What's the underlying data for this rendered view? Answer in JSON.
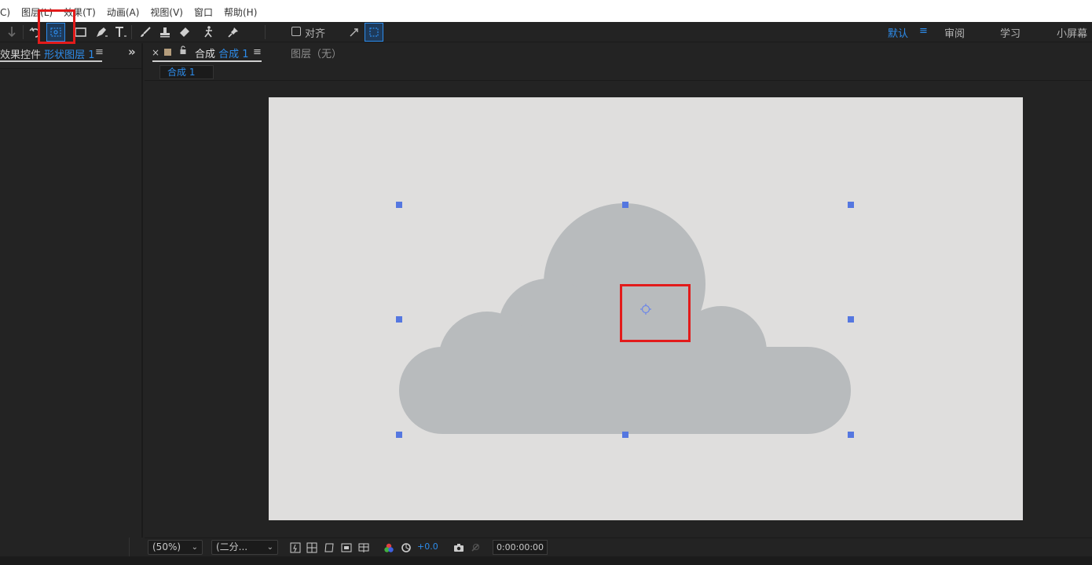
{
  "menu": {
    "items": [
      "C)",
      "图层(L)",
      "效果(T)",
      "动画(A)",
      "视图(V)",
      "窗口",
      "帮助(H)"
    ]
  },
  "toolbar": {
    "tools": [
      "selection-tool",
      "rotate-tool",
      "pan-behind-tool",
      "rectangle-tool",
      "pen-tool",
      "type-tool",
      "brush-tool",
      "clone-stamp-tool",
      "eraser-tool",
      "roto-brush-tool",
      "puppet-pin-tool"
    ],
    "snap_label": "对齐",
    "workspaces": [
      "默认",
      "审阅",
      "学习",
      "小屏幕"
    ],
    "workspace_menu": "≡",
    "active_workspace": "默认"
  },
  "left_panel": {
    "tab_prefix": "效果控件",
    "tab_layer": "形状图层 1",
    "menu_icon": "≡",
    "expand_icon": "»"
  },
  "comp_panel": {
    "close": "×",
    "tab_prefix": "合成",
    "tab_name": "合成 1",
    "menu_icon": "≡",
    "layer_tab": "图层（无）",
    "breadcrumb": "合成 1"
  },
  "canvas": {
    "background": "#dfdedd",
    "shape_color": "#b8bbbd",
    "handle_color": "#5577e0",
    "highlight_color": "#e21b1b"
  },
  "footer": {
    "zoom": "(50%)",
    "resolution": "(二分...",
    "exposure": "+0.0",
    "timecode": "0:00:00:00"
  }
}
